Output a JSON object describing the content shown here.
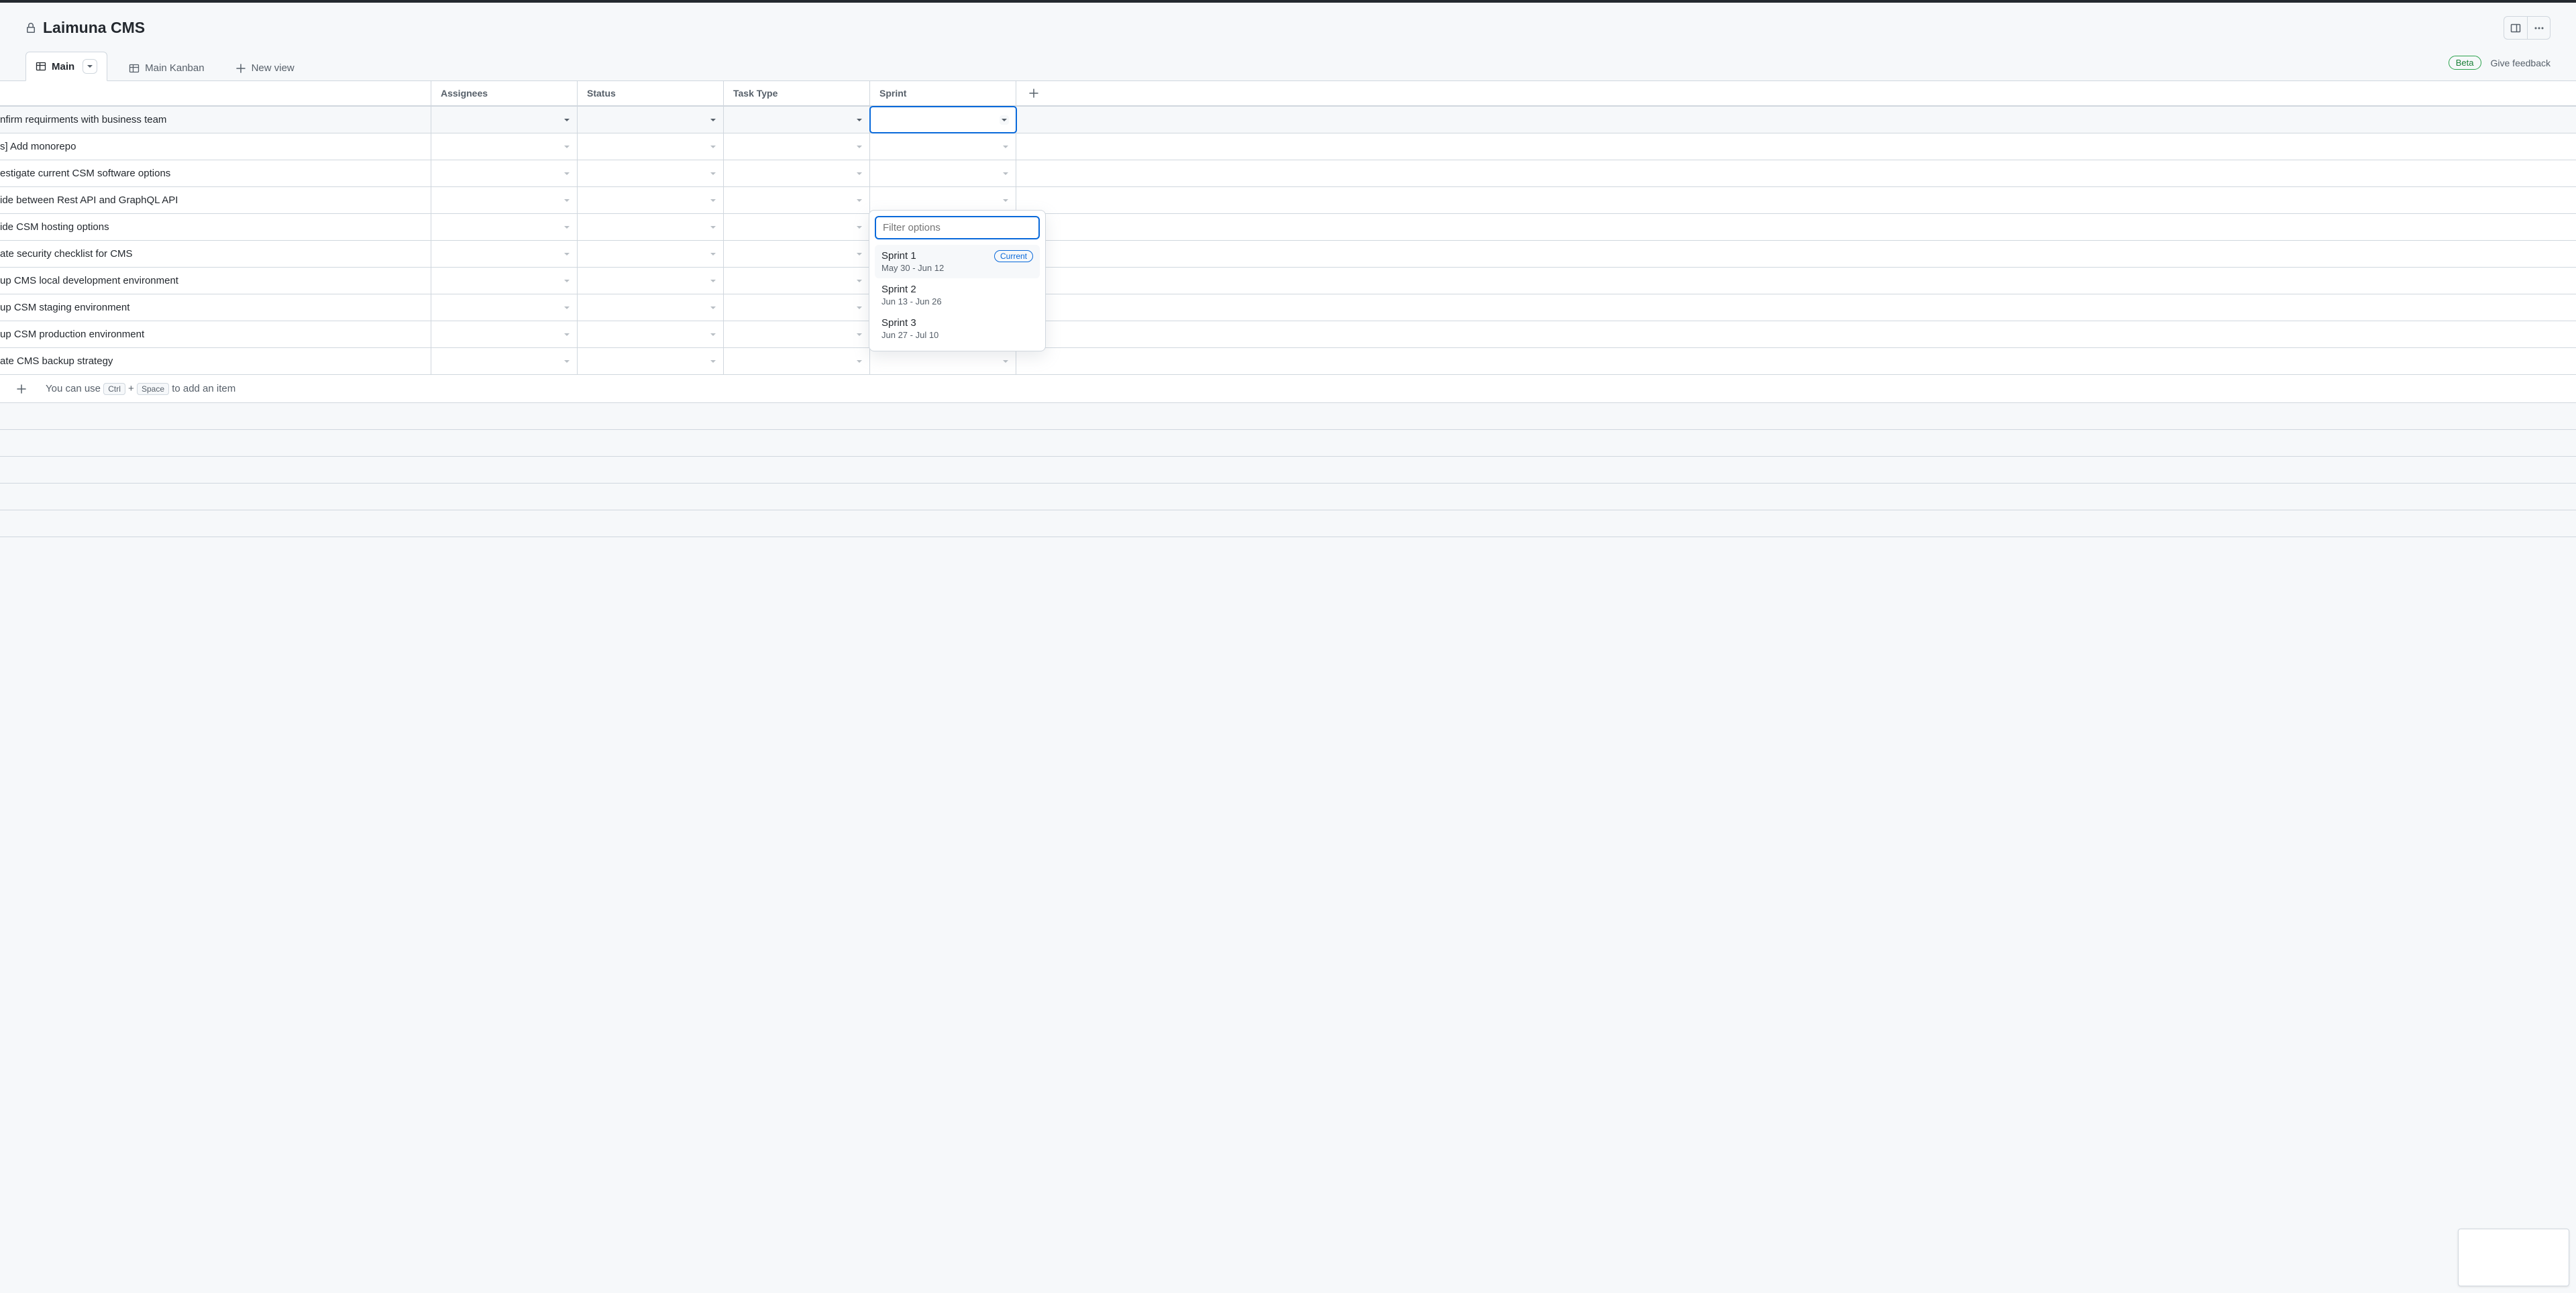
{
  "header": {
    "title": "Laimuna CMS"
  },
  "tabs": {
    "main": "Main",
    "kanban": "Main Kanban",
    "new_view": "New view"
  },
  "badges": {
    "beta": "Beta",
    "feedback": "Give feedback"
  },
  "columns": {
    "assignees": "Assignees",
    "status": "Status",
    "task_type": "Task Type",
    "sprint": "Sprint"
  },
  "rows": [
    {
      "title": "nfirm requirments with business team"
    },
    {
      "title": "s] Add monorepo"
    },
    {
      "title": "estigate current CSM software options"
    },
    {
      "title": "ide between Rest API and GraphQL API"
    },
    {
      "title": "ide CSM hosting options"
    },
    {
      "title": "ate security checklist for CMS"
    },
    {
      "title": "up CMS local development environment"
    },
    {
      "title": "up CSM staging environment"
    },
    {
      "title": "up CSM production environment"
    },
    {
      "title": "ate CMS backup strategy"
    }
  ],
  "add_row": {
    "text_before": "You can use",
    "key1": "Ctrl",
    "plus": "+",
    "key2": "Space",
    "text_after": "to add an item"
  },
  "dropdown": {
    "filter_placeholder": "Filter options",
    "options": [
      {
        "name": "Sprint 1",
        "dates": "May 30 - Jun 12",
        "current": true
      },
      {
        "name": "Sprint 2",
        "dates": "Jun 13 - Jun 26",
        "current": false
      },
      {
        "name": "Sprint 3",
        "dates": "Jun 27 - Jul 10",
        "current": false
      }
    ],
    "current_label": "Current"
  }
}
